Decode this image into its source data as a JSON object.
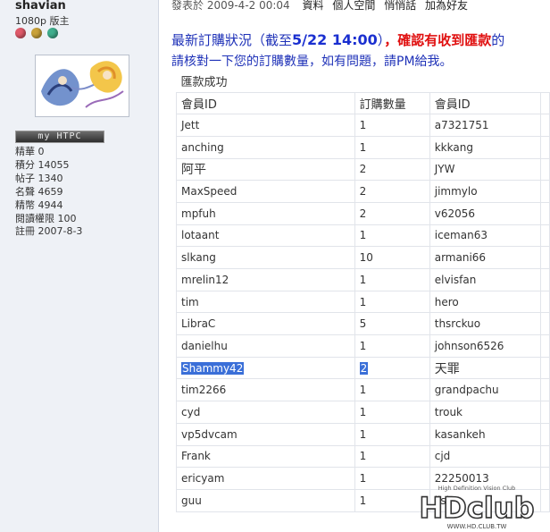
{
  "user": {
    "name": "shavian",
    "title": "1080p 版主",
    "medals": [
      "#e05a6a",
      "#c9a23a",
      "#3fae8d"
    ],
    "badge": "my HTPC",
    "stats": [
      "精華 0",
      "積分 14055",
      "帖子 1340",
      "名聲 4659",
      "精幣 4944",
      "閱讀權限 100",
      "註冊 2007-8-3"
    ]
  },
  "post": {
    "date": "發表於 2009-4-2 00:04",
    "links": [
      "資料",
      "個人空間",
      "悄悄話",
      "加為好友"
    ],
    "msg_prefix": "最新訂購狀況（截至",
    "msg_time": "5/22 14:00",
    "msg_close": "）",
    "msg_red": "，確認有收到匯款",
    "msg_tail": "的",
    "msg_line2": "請核對一下您的訂購數量，如有問題，請PM給我。"
  },
  "table": {
    "caption": "匯款成功",
    "headers": [
      "會員ID",
      "訂購數量",
      "會員ID"
    ],
    "rows": [
      [
        "Jett",
        "1",
        "a7321751"
      ],
      [
        "anching",
        "1",
        "kkkang"
      ],
      [
        "阿平",
        "2",
        "JYW"
      ],
      [
        "MaxSpeed",
        "2",
        "jimmylo"
      ],
      [
        "mpfuh",
        "2",
        "v62056"
      ],
      [
        "lotaant",
        "1",
        "iceman63"
      ],
      [
        "slkang",
        "10",
        "armani66"
      ],
      [
        "mrelin12",
        "1",
        "elvisfan"
      ],
      [
        "tim",
        "1",
        "hero"
      ],
      [
        "LibraC",
        "5",
        "thsrckuo"
      ],
      [
        "danielhu",
        "1",
        "johnson6526"
      ],
      [
        "Shammy42",
        "2",
        "天罪"
      ],
      [
        "tim2266",
        "1",
        "grandpachu"
      ],
      [
        "cyd",
        "1",
        "trouk"
      ],
      [
        "vp5dvcam",
        "1",
        "kasankeh"
      ],
      [
        "Frank",
        "1",
        "cjd"
      ],
      [
        "ericyam",
        "1",
        "22250013"
      ],
      [
        "guu",
        "1",
        "lisk"
      ]
    ]
  },
  "watermark": {
    "tagline": "High Definition Vision Club",
    "logo": "HDclub",
    "site": "WWW.HD.CLUB.TW"
  }
}
